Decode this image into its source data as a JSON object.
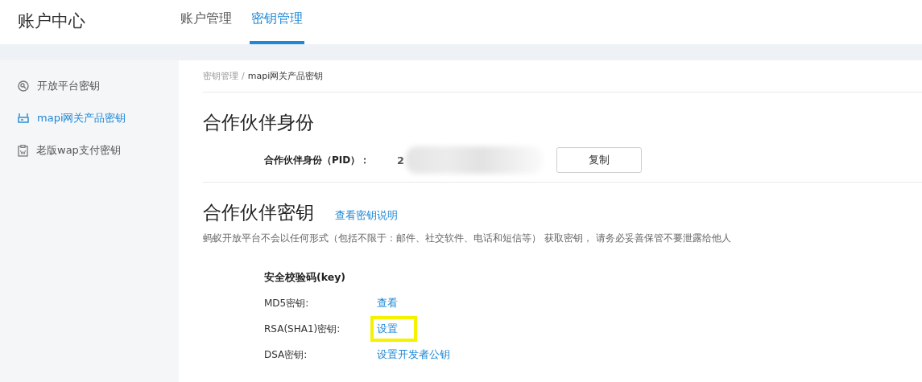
{
  "header": {
    "title": "账户中心",
    "tabs": [
      {
        "label": "账户管理",
        "selected": false
      },
      {
        "label": "密钥管理",
        "selected": true
      }
    ]
  },
  "sidebar": {
    "items": [
      {
        "label": "开放平台密钥",
        "kind": "key",
        "selected": false
      },
      {
        "label": "mapi网关产品密钥",
        "kind": "gateway",
        "selected": true
      },
      {
        "label": "老版wap支付密钥",
        "kind": "wap",
        "selected": false
      }
    ]
  },
  "breadcrumb": [
    {
      "label": "密钥管理",
      "current": false
    },
    {
      "label": "mapi网关产品密钥",
      "current": true
    }
  ],
  "breadcrumb_separator": "/",
  "partner_identity": {
    "title": "合作伙伴身份",
    "label": "合作伙伴身份（PID）：",
    "value": "2",
    "redacted": true,
    "button": "复制"
  },
  "partner_key": {
    "title": "合作伙伴密钥",
    "link": "查看密钥说明",
    "note": "蚂蚁开放平台不会以任何形式（包括不限于：邮件、社交软件、电话和短信等） 获取密钥， 请务必妥善保管不要泄露给他人",
    "heading": "安全校验码(key)",
    "rows": [
      {
        "label": "MD5密钥:",
        "action": "查看",
        "highlighted": false
      },
      {
        "label": "RSA(SHA1)密钥:",
        "action": "设置",
        "highlighted": true
      },
      {
        "label": "DSA密钥:",
        "action": "设置开发者公钥",
        "highlighted": false
      }
    ]
  }
}
